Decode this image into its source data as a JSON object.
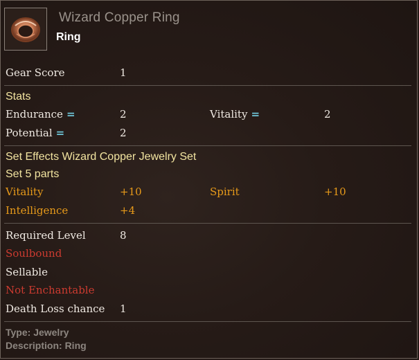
{
  "item": {
    "name": "Wizard Copper Ring",
    "type": "Ring",
    "icon": "copper-ring-icon"
  },
  "gear_score": {
    "label": "Gear Score",
    "value": "1"
  },
  "stats": {
    "title": "Stats",
    "entries": [
      {
        "label": "Endurance",
        "value": "2"
      },
      {
        "label": "Vitality",
        "value": "2"
      },
      {
        "label": "Potential",
        "value": "2"
      }
    ]
  },
  "set_effects": {
    "title": "Set Effects Wizard Copper Jewelry Set",
    "parts": "Set 5 parts",
    "bonuses": [
      {
        "label": "Vitality",
        "value": "+10"
      },
      {
        "label": "Spirit",
        "value": "+10"
      },
      {
        "label": "Intelligence",
        "value": "+4"
      }
    ]
  },
  "requirements": {
    "required_level_label": "Required Level",
    "required_level_value": "8",
    "soulbound": "Soulbound",
    "sellable": "Sellable",
    "enchantable": "Not Enchantable",
    "death_loss_label": "Death Loss chance",
    "death_loss_value": "1"
  },
  "footer": {
    "type": "Type: Jewelry",
    "description": "Description: Ring"
  },
  "colors": {
    "stat_bonus": "#e79a1a",
    "warning": "#cc3b30",
    "section_title": "#f2e4a0",
    "equal_marker": "#6fc6d8"
  }
}
